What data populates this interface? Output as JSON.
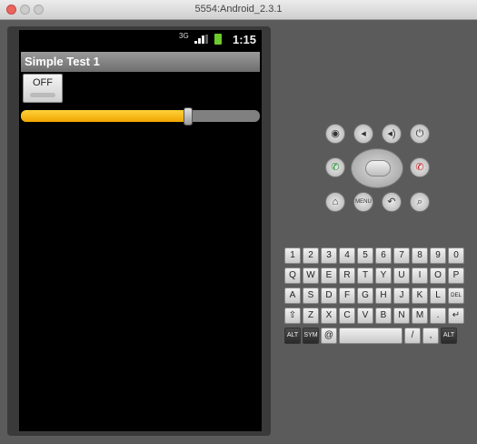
{
  "window": {
    "title": "5554:Android_2.3.1"
  },
  "statusbar": {
    "network": "3G",
    "time": "1:15"
  },
  "app": {
    "title": "Simple Test 1"
  },
  "toggle": {
    "label": "OFF"
  },
  "seekbar": {
    "progress": 0.7
  },
  "hardware_buttons": [
    {
      "name": "camera-button",
      "glyph": "◉"
    },
    {
      "name": "volume-down-button",
      "glyph": "◂"
    },
    {
      "name": "volume-up-button",
      "glyph": "◂)"
    },
    {
      "name": "power-button",
      "glyph": "⏻"
    },
    {
      "name": "call-button",
      "glyph": "✆"
    },
    {
      "name": "end-call-button",
      "glyph": "✆"
    },
    {
      "name": "home-button",
      "glyph": "⌂"
    },
    {
      "name": "menu-button",
      "glyph": "MENU"
    },
    {
      "name": "back-button",
      "glyph": "↶"
    },
    {
      "name": "search-button",
      "glyph": "⌕"
    }
  ],
  "keyboard": {
    "rows": [
      [
        "1",
        "2",
        "3",
        "4",
        "5",
        "6",
        "7",
        "8",
        "9",
        "0"
      ],
      [
        "Q",
        "W",
        "E",
        "R",
        "T",
        "Y",
        "U",
        "I",
        "O",
        "P"
      ],
      [
        "A",
        "S",
        "D",
        "F",
        "G",
        "H",
        "J",
        "K",
        "L",
        "DEL"
      ],
      [
        "⇧",
        "Z",
        "X",
        "C",
        "V",
        "B",
        "N",
        "M",
        ".",
        "↵"
      ],
      [
        "ALT",
        "SYM",
        "@",
        "",
        "/",
        ",",
        "ALT"
      ]
    ]
  }
}
